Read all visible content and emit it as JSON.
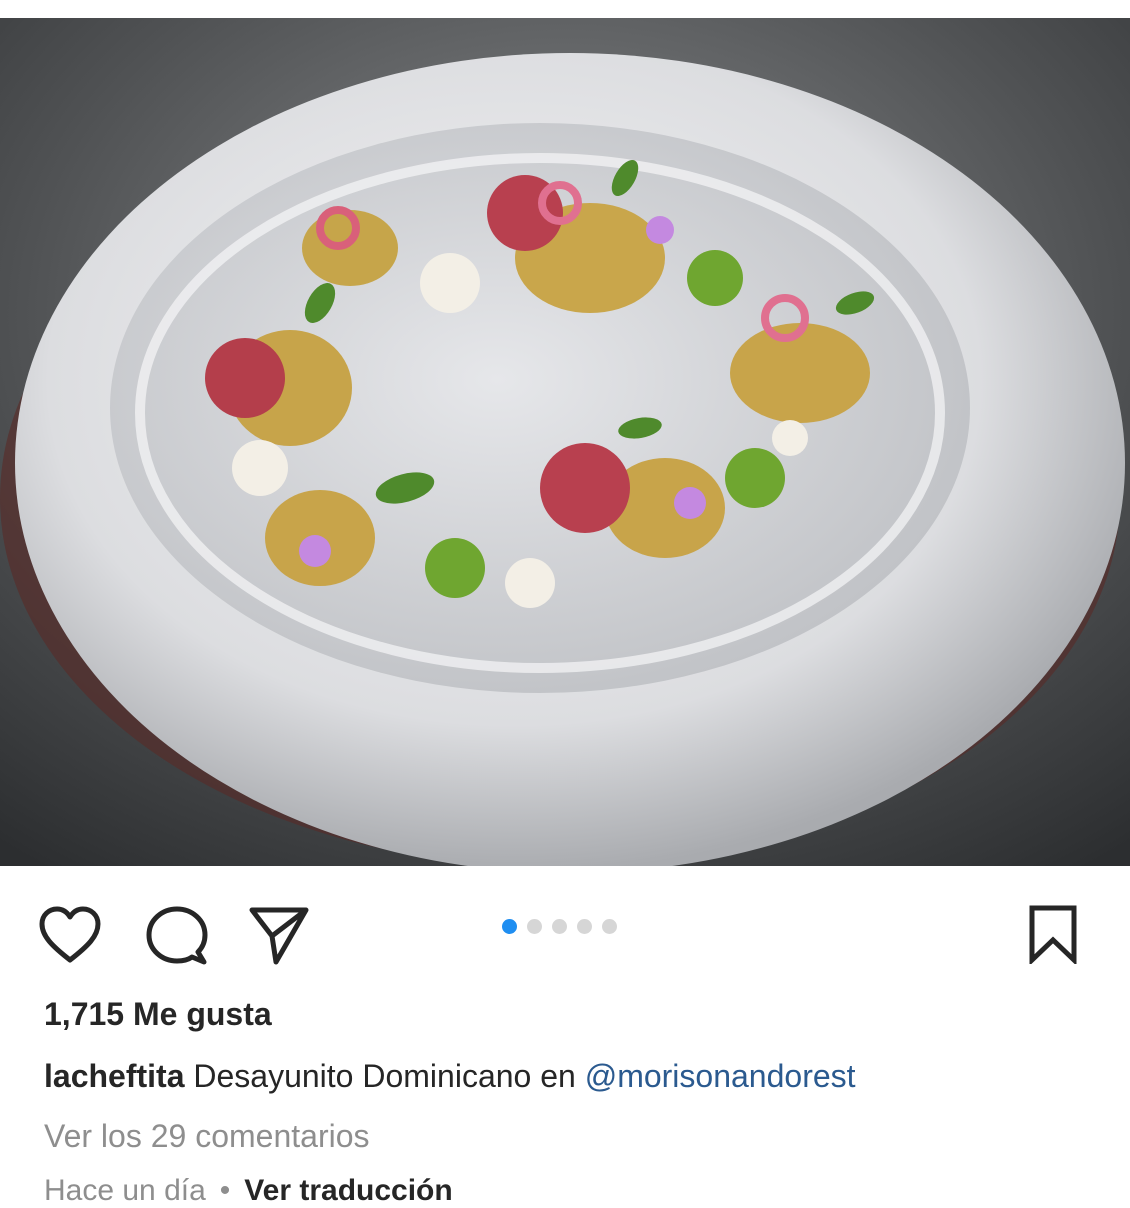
{
  "post": {
    "image": {
      "description": "plated-dish-photo",
      "slide_count": 5,
      "active_slide_index": 0
    },
    "actions": {
      "like_icon": "heart-icon",
      "comment_icon": "comment-icon",
      "share_icon": "send-icon",
      "save_icon": "bookmark-icon"
    },
    "likes_text": "1,715 Me gusta",
    "caption": {
      "username": "lacheftita",
      "text": "Desayunito Dominicano en",
      "mention": "@morisonandorest"
    },
    "view_comments": "Ver los 29 comentarios",
    "time_ago": "Hace un día",
    "separator": "•",
    "translate_link": "Ver traducción",
    "colors": {
      "accent_dot": "#1f8ef1",
      "inactive_dot": "#d6d6d6",
      "mention": "#2b5a8f",
      "muted_text": "#8e8e8e",
      "primary_text": "#262626"
    }
  }
}
